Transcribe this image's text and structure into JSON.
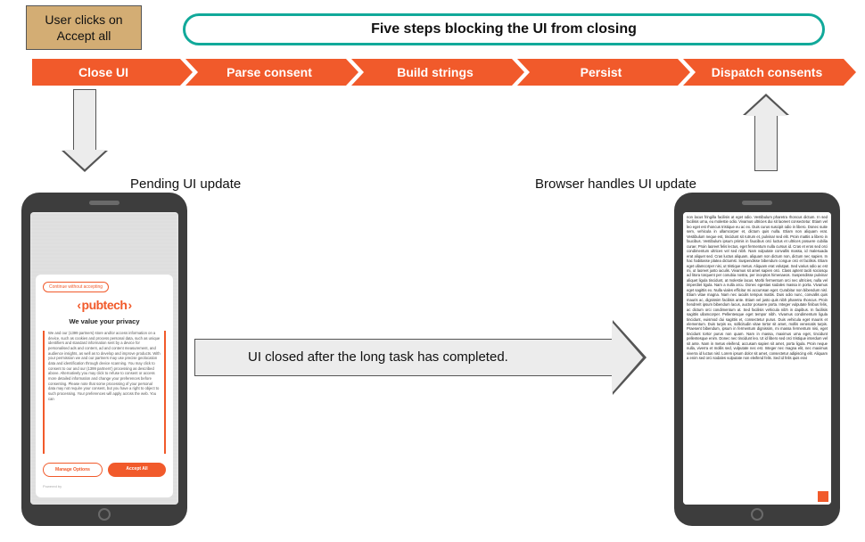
{
  "tan_box": "User clicks on Accept all",
  "teal_title": "Five steps blocking the UI from closing",
  "steps": [
    "Close UI",
    "Parse consent",
    "Build strings",
    "Persist",
    "Dispatch consents"
  ],
  "label_pending": "Pending UI update",
  "label_browser": "Browser handles UI update",
  "label_middle": "UI closed after the long task has completed.",
  "consent": {
    "continue_without": "Continue without accepting",
    "brand": "pubtech",
    "tagline": "We value your privacy",
    "body": "We and our (1399 partners) store and/or access information on a device, such as cookies and process personal data, such as unique identifiers and standard information sent by a device for personalised ads and content, ad and content measurement, and audience insights, as well as to develop and improve products. With your permission we and our partners may use precise geolocation data and identification through device scanning. You may click to consent to our and our (1399 partners') processing as described above. Alternatively you may click to refuse to consent or access more detailed information and change your preferences before consenting. Please note that some processing of your personal data may not require your consent, but you have a right to object to such processing. Your preferences will apply across the web. You can",
    "manage": "Manage Options",
    "accept": "Accept All",
    "powered": "Powered by"
  },
  "lorem": "non lacus fringilla facilisis at eget odio. Vestibulum pharetra rhoncus dictum. In sed facilisis urna, eu molestie odio. Vivamus ultricies dui sit laoreet consectetur. Etiam vel leo eget est rhoncus tristique eu ac ex. Duis curus suscipit odio in libero. Donec suite sem, vehicula in ullamcorper et, dictum quis nulla. Etiam non aliquam erat. Vestibulum neque est, tincidunt sit rutrum et, pulvinar sed elit. Proin mattis a libero in faucibus. Vestibulum ipsum primis in faucibus orci luctus et ultrices posuere cubilia curae; Proin laoreet felis lectus, eget fermentum nulla cursus id. Cras et eros sed orci condimentum ultrices vel sed nibh. Nam vulputate convallis massa, id malesuada erat aliquet sed. Cras luctus aliquam, aliquam non dictum non, dictum nec sapien. In hac habitasse platea dictumst. Suspendisse bibendum congue orci et facilisis. Etiam eget ullamcorper nisi, ut tristique metus. Aliquam erat volutpat. Sed varius odio ac est mi, ut laoreet justo iaculis. Vivamus sit amet sapien orci. Class aptent taciti sociosqu ad litora torquent per conubia nostra, per inceptos himenaeos. Suspendisse pulvinar aliquet ligula tincidunt, at molestie lacus. Morbi fermentum orci nec ultricies, nulla vel imperdiet ligula. Nam a nulla arcu. Donec egestas sodales massa in porta. Vivamus eget sagittis ex. Nulla viales efficitur mi accumsan eget. Curabitur non bibendum nisl. Etiam vitae magna. Nam nec iaculis tempus mattis. Duis odio nunc, convallis quis mauris ac, dignissim facilisis ante. Etiam vel justo quis nibh pharetra rhoncus. Proin hendrerit ipsum bibendum lacus, auctor posuere porta. Integer vulputate finibus felis, ac dictum orci condimentum at. Sed facilisis vehicula nibh in dapibus. In facilisis sagittis ullamcorper. Pellentesque eget tempor nibh. Vivamus condimentum ligula tincidunt, euismod dui sagittis et, consectetur purus. Duis vehicula eget mauris et elementum. Duis turpis ex, sollicitudin vitae tortor sit amet, mollis venenatis turpis. Praesent bibendum, ipsum in fermentum dignissim, mi massa fermentum nisi, eget tincidunt tortor purus non quam. Nam in massa, maximus urna eget, tincidunt pellentesque enim. Donec nec tincidunt leo. Ut id libero sed orci tristique interdum vel sit ante. Nam in metus eleifend, accusam sapien sit amet, porta ligula. Proin neque nulla, viverra et mollis sed, vulputate nec est. Integer nec magna elit, nec maximus viverra id luctus nisl. Lorem ipsum dolor sit amet, consectetur adipiscing elit. Aliquam a enim sed orci sodales vulputate non eleifend felis. Sed id felis quis erat"
}
